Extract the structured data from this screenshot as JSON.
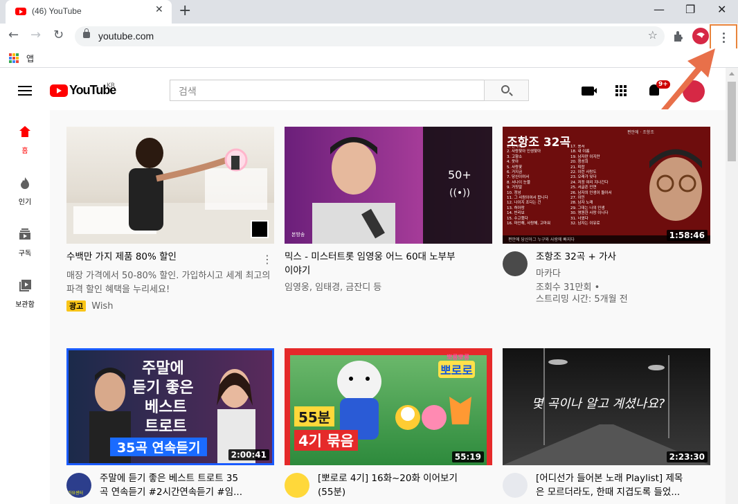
{
  "browser": {
    "tab_title": "(46) YouTube",
    "tab_close": "✕",
    "new_tab": "+",
    "url": "youtube.com",
    "bookmarks_apps": "앱",
    "window": {
      "minimize": "—",
      "maximize": "❐",
      "close": "✕"
    }
  },
  "youtube": {
    "logo": "YouTube",
    "logo_region": "KR",
    "search_placeholder": "검색",
    "notification_count": "9+",
    "sidebar": [
      {
        "label": "홈",
        "icon": "home-icon"
      },
      {
        "label": "인기",
        "icon": "trending-icon"
      },
      {
        "label": "구독",
        "icon": "subscriptions-icon"
      },
      {
        "label": "보관함",
        "icon": "library-icon"
      }
    ],
    "videos": [
      {
        "title": "수백만 가지 제품 80% 할인",
        "desc": "매장 가격에서 50-80% 할인. 가입하시고 세계 최고의 파격 할인 혜택을 누리세요!",
        "ad_label": "광고",
        "channel": "Wish"
      },
      {
        "title_line1": "믹스 - 미스터트롯 임영웅 어느 60대 노부부",
        "title_line2": "이야기",
        "channel": "임영웅, 임태경, 금잔디 등",
        "playlist_count": "50+",
        "thumb_tag": "본방송"
      },
      {
        "title": "조항조 32곡 + 가사",
        "channel": "마카다",
        "views": "조회수 31만회 •",
        "streamed": "스트리밍 시간: 5개월 전",
        "duration": "1:58:46",
        "thumb_text": "조항조  32곡",
        "thumb_tag": "편안에 · 조항조",
        "thumb_bottom": "편안에 당신아그 누구와 사랑에 빠지다"
      },
      {
        "title_line1": "주말에 듣기 좋은 베스트 트로트 35",
        "title_line2": "곡 연속듣기 #2시간연속듣기 #임...",
        "duration": "2:00:41",
        "thumb_l1": "주말에",
        "thumb_l2": "듣기 좋은",
        "thumb_l3": "베스트",
        "thumb_l4": "트로트",
        "thumb_l5": "35곡 연속듣기",
        "channel_avatar_text": "가요센터"
      },
      {
        "title_line1": "[뽀로로 4기] 16화~20화 이어보기",
        "title_line2": "(55분)",
        "duration": "55:19",
        "thumb_l1": "55분",
        "thumb_l2": "4기 묶음",
        "thumb_logo_top": "뽀롱뽀롱",
        "thumb_logo": "뽀로로"
      },
      {
        "title_line1": "[어디선가 들어본 노래 Playlist] 제목",
        "title_line2": "은 모르더라도, 한때 지겹도록 들었...",
        "duration": "2:23:30",
        "thumb_text": "몇 곡이나 알고 계셨나요?"
      }
    ],
    "track_list_left": [
      "1. 안약에",
      "2. 사랑찾아 인생찾아",
      "3. 고향소",
      "4. 옷아",
      "5. 사랑꽃",
      "6. 거지금",
      "7. 당신이여서",
      "8. 서나이 눈물",
      "9. 거짓말",
      "10. 정넝",
      "11. 그 사람이여서 합니다",
      "12. 나이지 조다는 건",
      "13. 허아랑",
      "14. 빈리보",
      "15. 수고했다",
      "16. 마인해, 사랑해, 고마워"
    ],
    "track_list_right": [
      "17. 용서",
      "18. 내 이름",
      "19. 남자란 이지만",
      "20. 청성희",
      "21. 피랍",
      "22. 이런 사랑도",
      "23. 오래가 잊다",
      "24. 저정 여리 지나간다",
      "25. 서글픈 인연",
      "26. 남자의 인생이 돌아서",
      "27. 이민",
      "28. 남자 노래",
      "29. 그대는 나의 인생",
      "30. 영원한 사랑 이니다",
      "31. 너였다",
      "32. 남자는 이유로"
    ],
    "colors": {
      "brand_red": "#ff0000",
      "highlight_orange": "#e8833a",
      "ad_yellow": "#f9c518"
    }
  }
}
